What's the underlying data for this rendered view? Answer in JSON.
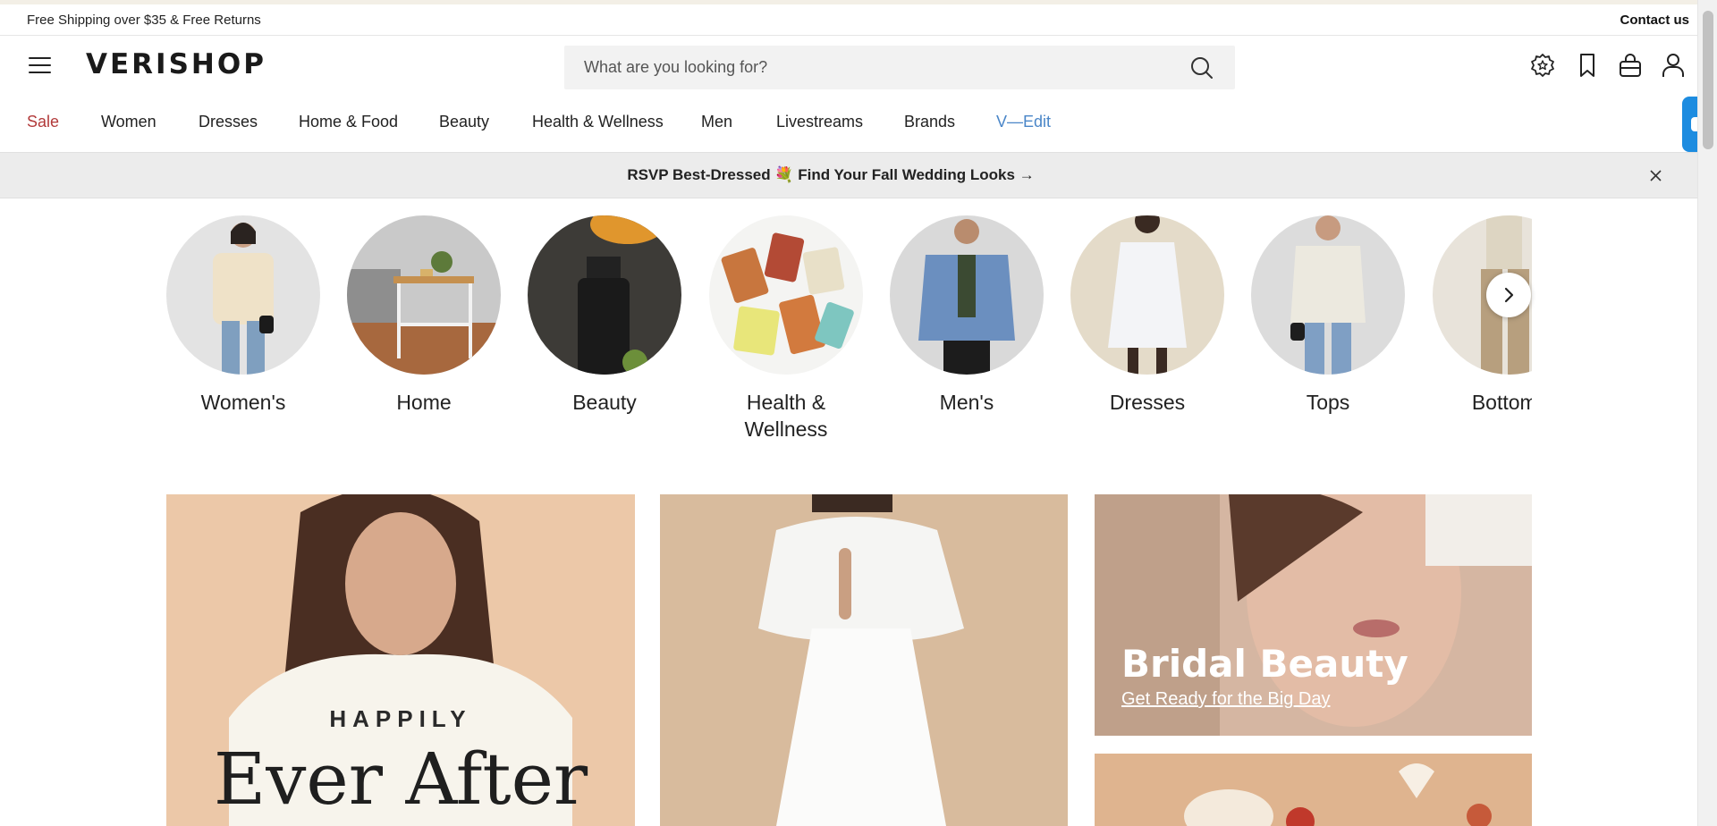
{
  "utility": {
    "shipping_text": "Free Shipping over $35 & Free Returns",
    "contact_label": "Contact us"
  },
  "header": {
    "logo": "VERISHOP",
    "search_placeholder": "What are you looking for?",
    "icons": [
      "rewards-icon",
      "bookmark-icon",
      "bag-icon",
      "account-icon"
    ]
  },
  "nav": {
    "items": [
      {
        "label": "Sale"
      },
      {
        "label": "Women"
      },
      {
        "label": "Dresses"
      },
      {
        "label": "Home & Food"
      },
      {
        "label": "Beauty"
      },
      {
        "label": "Health & Wellness"
      },
      {
        "label": "Men"
      },
      {
        "label": "Livestreams"
      },
      {
        "label": "Brands"
      },
      {
        "label": "V—Edit"
      }
    ]
  },
  "promo": {
    "text": "RSVP Best-Dressed 💐 Find Your Fall Wedding Looks →"
  },
  "categories": [
    {
      "label": "Women's"
    },
    {
      "label": "Home"
    },
    {
      "label": "Beauty"
    },
    {
      "label": "Health & Wellness"
    },
    {
      "label": "Men's"
    },
    {
      "label": "Dresses"
    },
    {
      "label": "Tops"
    },
    {
      "label": "Bottoms"
    }
  ],
  "heroes": {
    "happily": "HAPPILY",
    "ever_after": "Ever After",
    "bridal_title": "Bridal Beauty",
    "bridal_sub": "Get Ready for the Big Day"
  },
  "colors": {
    "sale": "#b23a3a",
    "vedit": "#4a86c8",
    "chat": "#1d8ce0",
    "promo_bg": "#ececec"
  }
}
